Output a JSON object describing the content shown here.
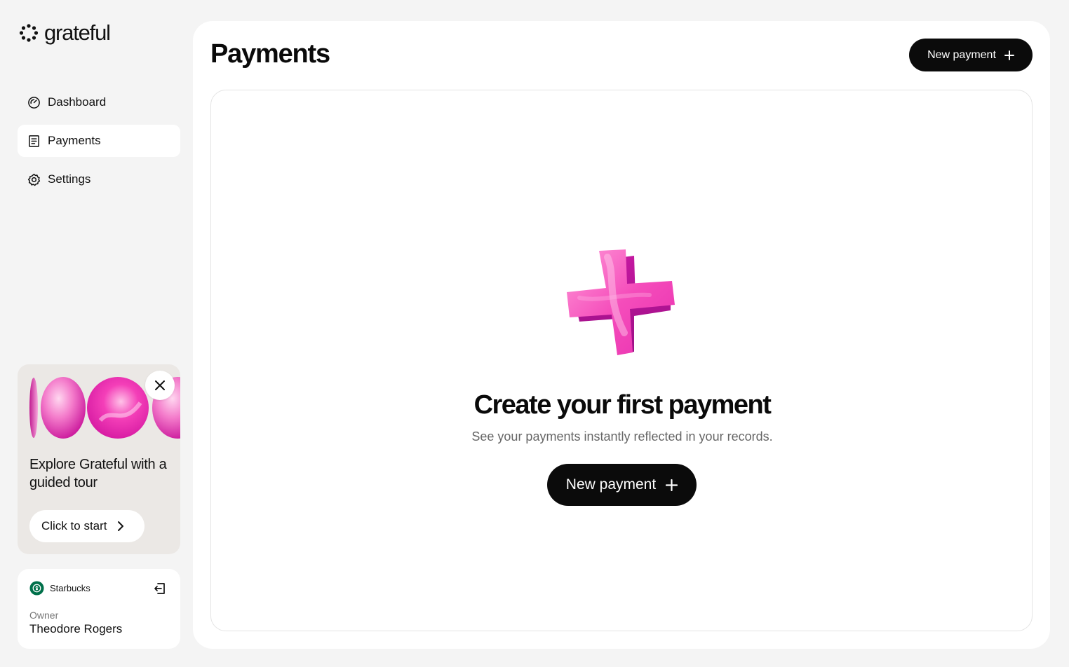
{
  "brand": {
    "name": "grateful",
    "icon": "sparkle-burst-logo"
  },
  "sidebar": {
    "items": [
      {
        "label": "Dashboard",
        "icon": "gauge-icon",
        "active": false
      },
      {
        "label": "Payments",
        "icon": "receipt-icon",
        "active": true
      },
      {
        "label": "Settings",
        "icon": "gear-icon",
        "active": false
      }
    ],
    "tour": {
      "title": "Explore Grateful with a guided tour",
      "button_label": "Click to start",
      "close_icon": "close-icon"
    },
    "account": {
      "company": "Starbucks",
      "role": "Owner",
      "name": "Theodore Rogers",
      "logout_icon": "logout-icon"
    }
  },
  "main": {
    "title": "Payments",
    "header_button_label": "New payment",
    "empty_state": {
      "title": "Create your first payment",
      "subtitle": "See your payments instantly reflected in your records.",
      "button_label": "New payment",
      "illustration": "pink-3d-plus-icon"
    }
  },
  "colors": {
    "background": "#f4f4f4",
    "surface": "#ffffff",
    "button": "#0b0b0b",
    "accent_pink": "#ee3fb5",
    "tour_card": "#ebe8e5"
  }
}
